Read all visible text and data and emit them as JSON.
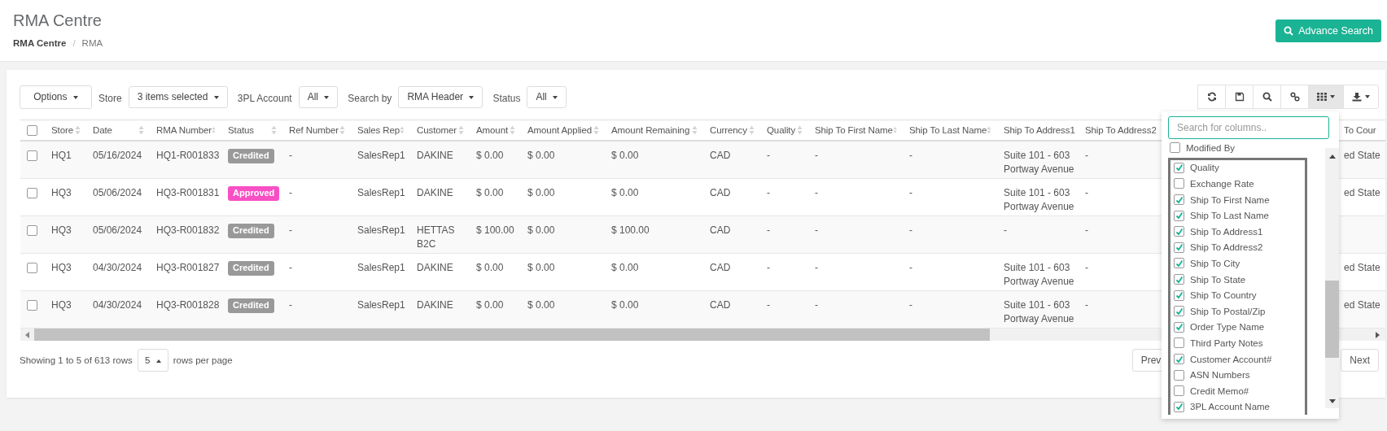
{
  "page": {
    "title": "RMA Centre",
    "breadcrumb": [
      {
        "label": "RMA Centre",
        "current": false
      },
      {
        "label": "RMA",
        "current": true
      }
    ],
    "breadcrumb_separator": "/",
    "advance_search": "Advance Search"
  },
  "filters": {
    "options": "Options",
    "fields": [
      {
        "label": "Store",
        "value": "3 items selected"
      },
      {
        "label": "3PL Account",
        "value": "All"
      },
      {
        "label": "Search by",
        "value": "RMA Header"
      },
      {
        "label": "Status",
        "value": "All"
      }
    ]
  },
  "toolbar": [
    {
      "kind": "refresh",
      "caret": false,
      "selected": false
    },
    {
      "kind": "save",
      "caret": false,
      "selected": false
    },
    {
      "kind": "search",
      "caret": false,
      "selected": false
    },
    {
      "kind": "link",
      "caret": false,
      "selected": false
    },
    {
      "kind": "columns",
      "caret": true,
      "selected": true
    },
    {
      "kind": "download",
      "caret": true,
      "selected": false
    }
  ],
  "table": {
    "header_checked": false,
    "columns": [
      "Store",
      "Date",
      "RMA Number",
      "Status",
      "Ref Number",
      "Sales Rep",
      "Customer",
      "Amount",
      "Amount Applied",
      "Amount Remaining",
      "Currency",
      "Quality",
      "Ship To First Name",
      "Ship To Last Name",
      "Ship To Address1",
      "Ship To Address2",
      "To Cour"
    ],
    "rows": [
      {
        "checked": false,
        "cells": [
          "HQ1",
          "05/16/2024",
          "HQ1-R001833",
          {
            "label": "Credited",
            "color": "#999999"
          },
          "-",
          "SalesRep1",
          "DAKINE",
          "$ 0.00",
          "$ 0.00",
          "$ 0.00",
          "CAD",
          "-",
          "-",
          "-",
          "Suite 101 - 603 Portway Avenue",
          "-",
          "ed State"
        ]
      },
      {
        "checked": false,
        "cells": [
          "HQ3",
          "05/06/2024",
          "HQ3-R001831",
          {
            "label": "Approved",
            "color": "#f84fc4"
          },
          "-",
          "SalesRep1",
          "DAKINE",
          "$ 0.00",
          "$ 0.00",
          "$ 0.00",
          "CAD",
          "-",
          "-",
          "-",
          "Suite 101 - 603 Portway Avenue",
          "-",
          "ed State"
        ]
      },
      {
        "checked": false,
        "cells": [
          "HQ3",
          "05/06/2024",
          "HQ3-R001832",
          {
            "label": "Credited",
            "color": "#999999"
          },
          "-",
          "SalesRep1",
          "HETTAS B2C",
          "$ 100.00",
          "$ 0.00",
          "$ 100.00",
          "CAD",
          "-",
          "-",
          "-",
          "-",
          "-"
        ]
      },
      {
        "checked": false,
        "cells": [
          "HQ3",
          "04/30/2024",
          "HQ3-R001827",
          {
            "label": "Credited",
            "color": "#999999"
          },
          "-",
          "SalesRep1",
          "DAKINE",
          "$ 0.00",
          "$ 0.00",
          "$ 0.00",
          "CAD",
          "-",
          "-",
          "-",
          "Suite 101 - 603 Portway Avenue",
          "-",
          "ed State"
        ]
      },
      {
        "checked": false,
        "cells": [
          "HQ3",
          "04/30/2024",
          "HQ3-R001828",
          {
            "label": "Credited",
            "color": "#999999"
          },
          "-",
          "SalesRep1",
          "DAKINE",
          "$ 0.00",
          "$ 0.00",
          "$ 0.00",
          "CAD",
          "-",
          "-",
          "-",
          "Suite 101 - 603 Portway Avenue",
          "-",
          "ed State"
        ]
      }
    ]
  },
  "pagination": {
    "summary": "Showing 1 to 5 of 613 rows",
    "page_size": "5",
    "page_size_suffix": "rows per page",
    "prev": "Prev",
    "next": "Next"
  },
  "column_menu": {
    "placeholder": "Search for columns..",
    "items": [
      {
        "label": "Modified By",
        "checked": false
      }
    ],
    "framed_items": [
      {
        "label": "Quality",
        "checked": true
      },
      {
        "label": "Exchange Rate",
        "checked": false
      },
      {
        "label": "Ship To First Name",
        "checked": true
      },
      {
        "label": "Ship To Last Name",
        "checked": true
      },
      {
        "label": "Ship To Address1",
        "checked": true
      },
      {
        "label": "Ship To Address2",
        "checked": true
      },
      {
        "label": "Ship To City",
        "checked": true
      },
      {
        "label": "Ship To State",
        "checked": true
      },
      {
        "label": "Ship To Country",
        "checked": true
      },
      {
        "label": "Ship To Postal/Zip",
        "checked": true
      },
      {
        "label": "Order Type Name",
        "checked": true
      },
      {
        "label": "Third Party Notes",
        "checked": false
      },
      {
        "label": "Customer Account#",
        "checked": true
      },
      {
        "label": "ASN Numbers",
        "checked": false
      },
      {
        "label": "Credit Memo#",
        "checked": false
      },
      {
        "label": "3PL Account Name",
        "checked": true
      }
    ]
  }
}
